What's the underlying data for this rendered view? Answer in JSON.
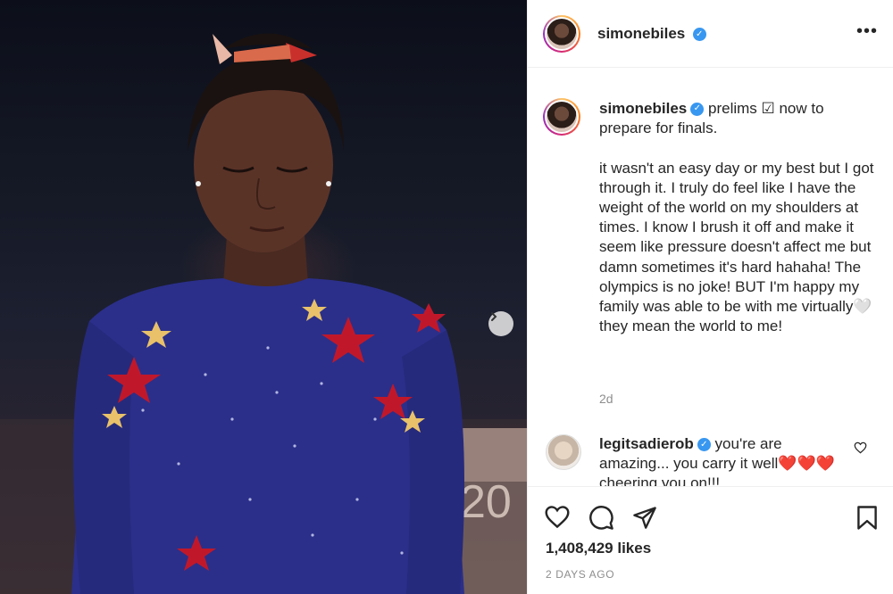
{
  "post": {
    "author": "simonebiles",
    "verified_glyph": "✓"
  },
  "header": {
    "username": "simonebiles",
    "more_label": "•••"
  },
  "caption": {
    "username": "simonebiles",
    "text": "prelims ☑ now to\nprepare for finals.\n\nit wasn't an easy day or my best but I got through it. I truly do feel like I have the weight of the world on my shoulders at times. I know I brush it off and make it seem like pressure doesn't affect me but damn sometimes it's hard hahaha! The olympics is no joke! BUT I'm happy my family was able to be with me virtually🤍 they mean the world to me!",
    "time": "2d"
  },
  "comment": {
    "username": "legitsadierob",
    "text": "you're are amazing... you carry it well❤️❤️❤️ cheering you on!!!"
  },
  "actions": {
    "likes": "1,408,429 likes",
    "time_ago": "2 DAYS AGO"
  },
  "photo": {
    "backdrop_text": "20"
  },
  "colors": {
    "verified": "#3897f0",
    "leotard": "#2b2f8a",
    "star_red": "#c0182a",
    "star_gold": "#e8c16a"
  },
  "icons": [
    "more-icon",
    "verified-icon",
    "heart-icon",
    "comment-icon",
    "share-icon",
    "bookmark-icon",
    "next-arrow-icon"
  ]
}
